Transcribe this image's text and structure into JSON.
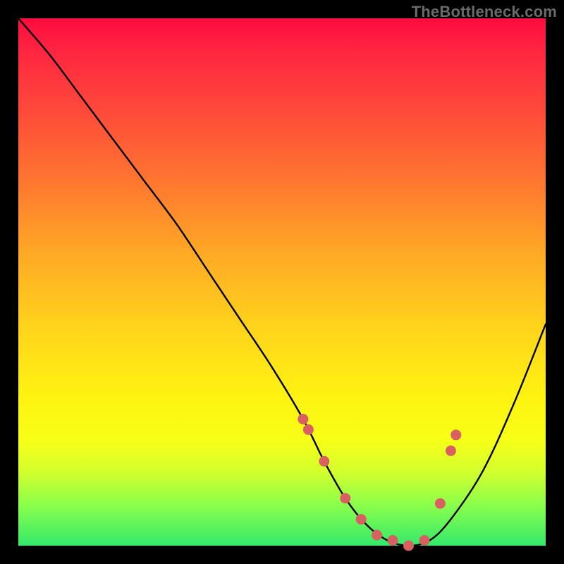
{
  "watermark": "TheBottleneck.com",
  "colors": {
    "background": "#000000",
    "curve": "#000000",
    "marker": "#d96060",
    "gradient_top": "#ff0b3f",
    "gradient_bottom": "#34e96b"
  },
  "chart_data": {
    "type": "line",
    "title": "",
    "xlabel": "",
    "ylabel": "",
    "xlim": [
      0,
      100
    ],
    "ylim": [
      0,
      100
    ],
    "grid": false,
    "legend": false,
    "series": [
      {
        "name": "bottleneck-curve",
        "x": [
          0,
          6,
          12,
          18,
          24,
          30,
          36,
          42,
          48,
          54,
          58,
          62,
          66,
          70,
          74,
          78,
          82,
          88,
          94,
          100
        ],
        "y": [
          100,
          93,
          85,
          77,
          69,
          61,
          52,
          43,
          34,
          24,
          16,
          9,
          4,
          1,
          0,
          1,
          5,
          14,
          27,
          42
        ]
      }
    ],
    "markers": {
      "name": "highlight-points",
      "x": [
        54,
        55,
        58,
        62,
        65,
        68,
        71,
        74,
        77,
        80,
        82,
        83
      ],
      "y": [
        24,
        22,
        16,
        9,
        5,
        2,
        1,
        0,
        1,
        8,
        18,
        21
      ]
    }
  }
}
